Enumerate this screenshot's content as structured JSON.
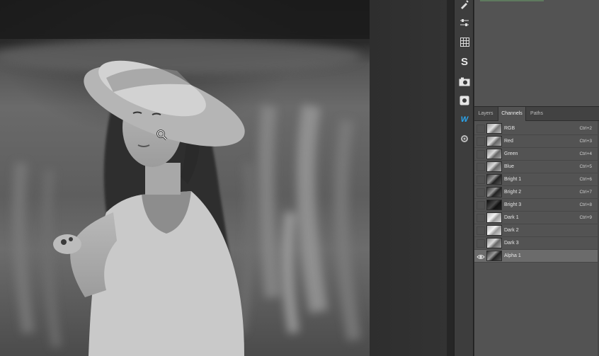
{
  "dock": {
    "buttons": [
      {
        "icon": "brush-settings-icon",
        "glyph": "✎"
      },
      {
        "icon": "adjustments-icon",
        "glyph": ""
      },
      {
        "icon": "grid-icon",
        "glyph": ""
      },
      {
        "icon": "styles-icon",
        "glyph": "S"
      },
      {
        "icon": "camera-icon",
        "glyph": ""
      },
      {
        "icon": "instagram-icon",
        "glyph": ""
      },
      {
        "icon": "w-plugin-icon",
        "glyph": "W"
      },
      {
        "icon": "plugin-icon",
        "glyph": ""
      }
    ]
  },
  "panel": {
    "tabs": [
      {
        "label": "Layers",
        "active": false
      },
      {
        "label": "Channels",
        "active": true
      },
      {
        "label": "Paths",
        "active": false
      }
    ],
    "channels": [
      {
        "name": "RGB",
        "shortcut": "Ctrl+2",
        "visible": false,
        "selected": false,
        "thumb": "color"
      },
      {
        "name": "Red",
        "shortcut": "Ctrl+3",
        "visible": false,
        "selected": false,
        "thumb": "gray"
      },
      {
        "name": "Green",
        "shortcut": "Ctrl+4",
        "visible": false,
        "selected": false,
        "thumb": "gray"
      },
      {
        "name": "Blue",
        "shortcut": "Ctrl+5",
        "visible": false,
        "selected": false,
        "thumb": "gray"
      },
      {
        "name": "Bright 1",
        "shortcut": "Ctrl+6",
        "visible": false,
        "selected": false,
        "thumb": "dark"
      },
      {
        "name": "Bright 2",
        "shortcut": "Ctrl+7",
        "visible": false,
        "selected": false,
        "thumb": "dark"
      },
      {
        "name": "Bright 3",
        "shortcut": "Ctrl+8",
        "visible": false,
        "selected": false,
        "thumb": "black"
      },
      {
        "name": "Dark 1",
        "shortcut": "Ctrl+9",
        "visible": false,
        "selected": false,
        "thumb": "light"
      },
      {
        "name": "Dark 2",
        "shortcut": "",
        "visible": false,
        "selected": false,
        "thumb": "light"
      },
      {
        "name": "Dark 3",
        "shortcut": "",
        "visible": false,
        "selected": false,
        "thumb": "gray"
      },
      {
        "name": "Alpha 1",
        "shortcut": "",
        "visible": true,
        "selected": true,
        "thumb": "dark"
      }
    ]
  },
  "canvas": {
    "cursor_icon": "zoom-cursor-icon"
  }
}
